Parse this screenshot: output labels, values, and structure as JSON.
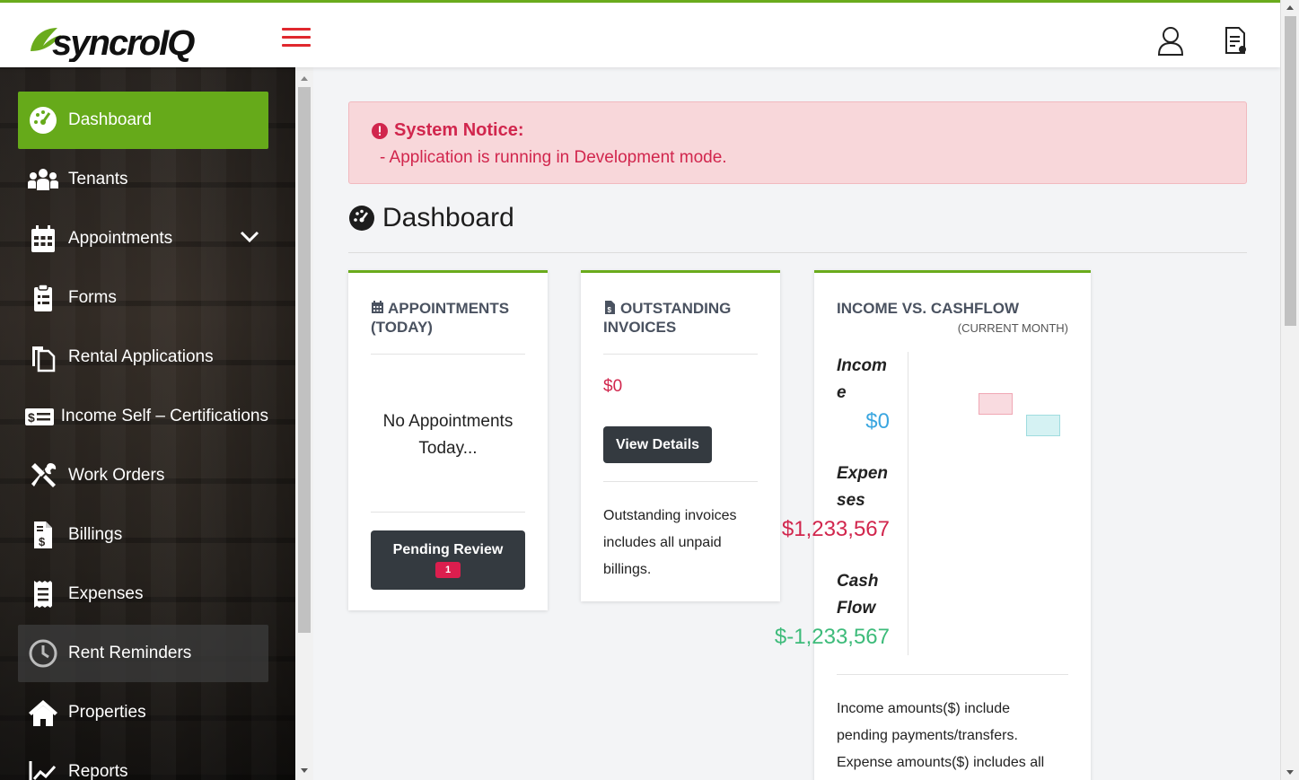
{
  "app": {
    "logo_text": "syncroIQ",
    "brand_color": "#66aa1a",
    "accent_red": "#e0282e"
  },
  "header": {
    "menu_icon": "hamburger-icon",
    "user_icon": "user-icon",
    "document_icon": "document-settings-icon"
  },
  "sidebar": {
    "items": [
      {
        "label": "Dashboard",
        "icon": "dashboard-gauge-icon",
        "active": true
      },
      {
        "label": "Tenants",
        "icon": "users-icon"
      },
      {
        "label": "Appointments",
        "icon": "calendar-icon",
        "expandable": true
      },
      {
        "label": "Forms",
        "icon": "clipboard-icon"
      },
      {
        "label": "Rental Applications",
        "icon": "copy-documents-icon"
      },
      {
        "label": "Income Self – Certifications",
        "icon": "money-bill-icon"
      },
      {
        "label": "Work Orders",
        "icon": "tools-icon"
      },
      {
        "label": "Billings",
        "icon": "invoice-dollar-icon"
      },
      {
        "label": "Expenses",
        "icon": "receipt-icon"
      },
      {
        "label": "Rent Reminders",
        "icon": "clock-icon",
        "highlighted": true
      },
      {
        "label": "Properties",
        "icon": "home-icon"
      },
      {
        "label": "Reports",
        "icon": "line-chart-icon"
      }
    ]
  },
  "notice": {
    "title": "System Notice:",
    "message": "- Application is running in Development mode."
  },
  "page": {
    "title": "Dashboard"
  },
  "cards": {
    "appointments": {
      "title": "APPOINTMENTS (TODAY)",
      "empty_line1": "No Appointments",
      "empty_line2": "Today...",
      "button_label": "Pending Review",
      "badge_count": "1"
    },
    "invoices": {
      "title": "OUTSTANDING INVOICES",
      "amount": "$0",
      "button_label": "View Details",
      "note_line1": "Outstanding invoices",
      "note_line2": "includes all unpaid",
      "note_line3": "billings."
    },
    "income": {
      "title": "INCOME VS. CASHFLOW",
      "subtitle": "(CURRENT MONTH)",
      "income_label_1": "Incom",
      "income_label_2": "e",
      "income_value": "$0",
      "expenses_label_1": "Expen",
      "expenses_label_2": "ses",
      "expenses_value": "$1,233,567",
      "cashflow_label_1": "Cash",
      "cashflow_label_2": "Flow",
      "cashflow_value": "$-1,233,567",
      "note_line1": "Income amounts($) include",
      "note_line2": "pending payments/transfers.",
      "note_line3": "Expense amounts($) includes all",
      "colors": {
        "income": "#3aa6e0",
        "expenses": "#d1264d",
        "cashflow": "#3dbb7a"
      }
    }
  }
}
